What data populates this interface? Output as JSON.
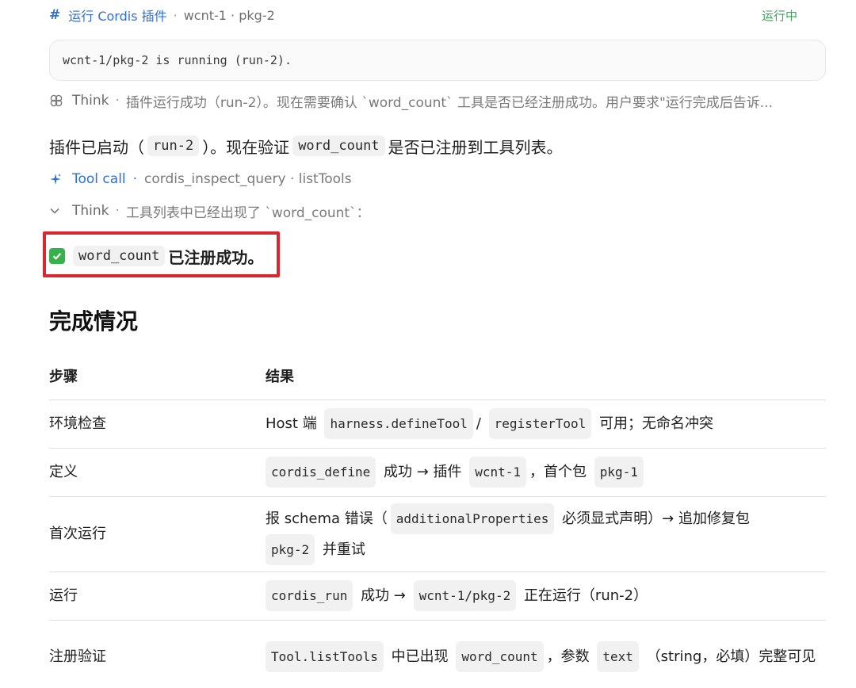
{
  "tool_header": {
    "hash": "#",
    "title": "运行 Cordis 插件",
    "separator": "·",
    "meta": "wcnt-1 · pkg-2",
    "status": "运行中"
  },
  "output": {
    "text": "wcnt-1/pkg-2 is running (run-2)."
  },
  "think1": {
    "label": "Think",
    "separator": "·",
    "text": "插件运行成功（run-2）。现在需要确认 `word_count` 工具是否已经注册成功。用户要求\"运行完成后告诉..."
  },
  "message": {
    "part1": "插件已启动（",
    "code1": "run-2",
    "part2": "）。现在验证",
    "code2": "word_count",
    "part3": "是否已注册到工具列表。"
  },
  "tool_call": {
    "label": "Tool call",
    "separator": "·",
    "meta": "cordis_inspect_query · listTools"
  },
  "think2": {
    "label": "Think",
    "separator": "·",
    "text": "工具列表中已经出现了 `word_count`："
  },
  "success": {
    "code": "word_count",
    "text": "已注册成功。"
  },
  "section_heading": "完成情况",
  "table": {
    "headers": [
      "步骤",
      "结果"
    ],
    "rows": [
      {
        "step": "环境检查",
        "r": [
          "Host 端",
          "harness.defineTool",
          "/",
          "registerTool",
          "可用；无命名冲突"
        ]
      },
      {
        "step": "定义",
        "r": [
          "cordis_define",
          "成功 → 插件",
          "wcnt-1",
          "，首个包",
          "pkg-1"
        ]
      },
      {
        "step": "首次运行",
        "r": [
          "报 schema 错误（",
          "additionalProperties",
          "必须显式声明）→ 追加修复包",
          "pkg-2",
          "并重试"
        ]
      },
      {
        "step": "运行",
        "r": [
          "cordis_run",
          "成功 →",
          "wcnt-1/pkg-2",
          "正在运行（run-2）"
        ]
      },
      {
        "step": "注册验证",
        "r": [
          "Tool.listTools",
          "中已出现",
          "word_count",
          "，参数",
          "text",
          "（string，必填）完整可见"
        ]
      }
    ]
  },
  "colors": {
    "accent": "#2f6fd6",
    "status": "#3aa55b",
    "highlight": "#d9262f"
  },
  "icons": [
    "hash-icon",
    "think-icon",
    "sparkle-icon",
    "chevron-down-icon",
    "check-icon"
  ]
}
